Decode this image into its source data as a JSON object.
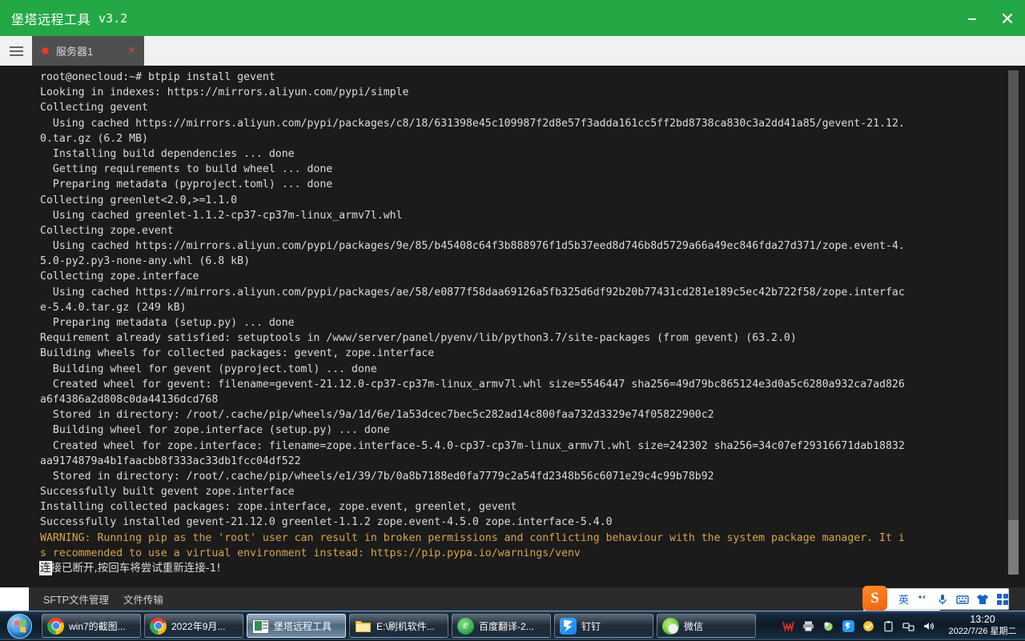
{
  "window": {
    "title": "堡塔远程工具",
    "version": "v3.2",
    "minimize_label": "minimize",
    "close_label": "close"
  },
  "tabstrip": {
    "menu_icon": "hamburger-icon",
    "tabs": [
      {
        "label": "服务器1",
        "status": "connected-dot",
        "close": "×"
      }
    ]
  },
  "terminal": {
    "lines": [
      {
        "text": "root@onecloud:~# btpip install gevent",
        "style": "normal"
      },
      {
        "text": "Looking in indexes: https://mirrors.aliyun.com/pypi/simple",
        "style": "normal"
      },
      {
        "text": "Collecting gevent",
        "style": "normal"
      },
      {
        "text": "  Using cached https://mirrors.aliyun.com/pypi/packages/c8/18/631398e45c109987f2d8e57f3adda161cc5ff2bd8738ca830c3a2dd41a85/gevent-21.12.",
        "style": "normal"
      },
      {
        "text": "0.tar.gz (6.2 MB)",
        "style": "normal"
      },
      {
        "text": "  Installing build dependencies ... done",
        "style": "normal"
      },
      {
        "text": "  Getting requirements to build wheel ... done",
        "style": "normal"
      },
      {
        "text": "  Preparing metadata (pyproject.toml) ... done",
        "style": "normal"
      },
      {
        "text": "Collecting greenlet<2.0,>=1.1.0",
        "style": "normal"
      },
      {
        "text": "  Using cached greenlet-1.1.2-cp37-cp37m-linux_armv7l.whl",
        "style": "normal"
      },
      {
        "text": "Collecting zope.event",
        "style": "normal"
      },
      {
        "text": "  Using cached https://mirrors.aliyun.com/pypi/packages/9e/85/b45408c64f3b888976f1d5b37eed8d746b8d5729a66a49ec846fda27d371/zope.event-4.",
        "style": "normal"
      },
      {
        "text": "5.0-py2.py3-none-any.whl (6.8 kB)",
        "style": "normal"
      },
      {
        "text": "Collecting zope.interface",
        "style": "normal"
      },
      {
        "text": "  Using cached https://mirrors.aliyun.com/pypi/packages/ae/58/e0877f58daa69126a5fb325d6df92b20b77431cd281e189c5ec42b722f58/zope.interfac",
        "style": "normal"
      },
      {
        "text": "e-5.4.0.tar.gz (249 kB)",
        "style": "normal"
      },
      {
        "text": "  Preparing metadata (setup.py) ... done",
        "style": "normal"
      },
      {
        "text": "Requirement already satisfied: setuptools in /www/server/panel/pyenv/lib/python3.7/site-packages (from gevent) (63.2.0)",
        "style": "normal"
      },
      {
        "text": "Building wheels for collected packages: gevent, zope.interface",
        "style": "normal"
      },
      {
        "text": "  Building wheel for gevent (pyproject.toml) ... done",
        "style": "normal"
      },
      {
        "text": "  Created wheel for gevent: filename=gevent-21.12.0-cp37-cp37m-linux_armv7l.whl size=5546447 sha256=49d79bc865124e3d0a5c6280a932ca7ad826",
        "style": "normal"
      },
      {
        "text": "a6f4386a2d808c0da44136dcd768",
        "style": "normal"
      },
      {
        "text": "  Stored in directory: /root/.cache/pip/wheels/9a/1d/6e/1a53dcec7bec5c282ad14c800faa732d3329e74f05822900c2",
        "style": "normal"
      },
      {
        "text": "  Building wheel for zope.interface (setup.py) ... done",
        "style": "normal"
      },
      {
        "text": "  Created wheel for zope.interface: filename=zope.interface-5.4.0-cp37-cp37m-linux_armv7l.whl size=242302 sha256=34c07ef29316671dab18832",
        "style": "normal"
      },
      {
        "text": "aa9174879a4b1faacbb8f333ac33db1fcc04df522",
        "style": "normal"
      },
      {
        "text": "  Stored in directory: /root/.cache/pip/wheels/e1/39/7b/0a8b7188ed0fa7779c2a54fd2348b56c6071e29c4c99b78b92",
        "style": "normal"
      },
      {
        "text": "Successfully built gevent zope.interface",
        "style": "normal"
      },
      {
        "text": "Installing collected packages: zope.interface, zope.event, greenlet, gevent",
        "style": "normal"
      },
      {
        "text": "Successfully installed gevent-21.12.0 greenlet-1.1.2 zope.event-4.5.0 zope.interface-5.4.0",
        "style": "normal"
      },
      {
        "text": "WARNING: Running pip as the 'root' user can result in broken permissions and conflicting behaviour with the system package manager. It i",
        "style": "warn"
      },
      {
        "text": "s recommended to use a virtual environment instead: https://pip.pypa.io/warnings/venv",
        "style": "warn"
      }
    ],
    "last_line": {
      "cursor_char": "连",
      "rest": "接已断开,按回车将尝试重新连接-1!"
    }
  },
  "statusbar": {
    "items": [
      {
        "label": "SFTP文件管理"
      },
      {
        "label": "文件传输"
      }
    ]
  },
  "ime": {
    "logo": "S",
    "mode": "英",
    "items": [
      {
        "name": "punctuation-icon",
        "glyph": "，"
      },
      {
        "name": "microphone-icon",
        "glyph": ""
      },
      {
        "name": "keyboard-icon",
        "glyph": ""
      },
      {
        "name": "skin-icon",
        "glyph": ""
      },
      {
        "name": "apps-icon",
        "glyph": ""
      }
    ]
  },
  "taskbar": {
    "start_label": "Start",
    "buttons": [
      {
        "label": "win7的截图...",
        "icon": "chrome-icon",
        "active": false
      },
      {
        "label": "2022年9月...",
        "icon": "chrome-icon",
        "active": false
      },
      {
        "label": "堡塔远程工具",
        "icon": "bt-tool-icon",
        "active": true
      },
      {
        "label": "E:\\刷机软件...",
        "icon": "folder-icon",
        "active": false
      },
      {
        "label": "百度翻译-2...",
        "icon": "se-browser-icon",
        "active": false
      },
      {
        "label": "钉钉",
        "icon": "dingtalk-icon",
        "active": false
      },
      {
        "label": "微信",
        "icon": "wechat-icon",
        "active": false
      }
    ],
    "tray": [
      {
        "name": "wps-tray-icon"
      },
      {
        "name": "printer-tray-icon"
      },
      {
        "name": "green-shield-tray-icon"
      },
      {
        "name": "dingtalk-tray-icon"
      },
      {
        "name": "360-tray-icon"
      },
      {
        "name": "clipboard-tray-icon"
      },
      {
        "name": "network-tray-icon"
      },
      {
        "name": "volume-tray-icon"
      }
    ],
    "clock": {
      "time": "13:20",
      "date": "2022/7/26 星期二"
    }
  },
  "colors": {
    "titlebar_green": "#23a845",
    "terminal_bg": "#1b1b1b",
    "terminal_fg": "#dcdcdc",
    "warning_yellow": "#d8a54a",
    "tab_active_bg": "#4f4f4f",
    "close_red": "#d94b3f"
  }
}
